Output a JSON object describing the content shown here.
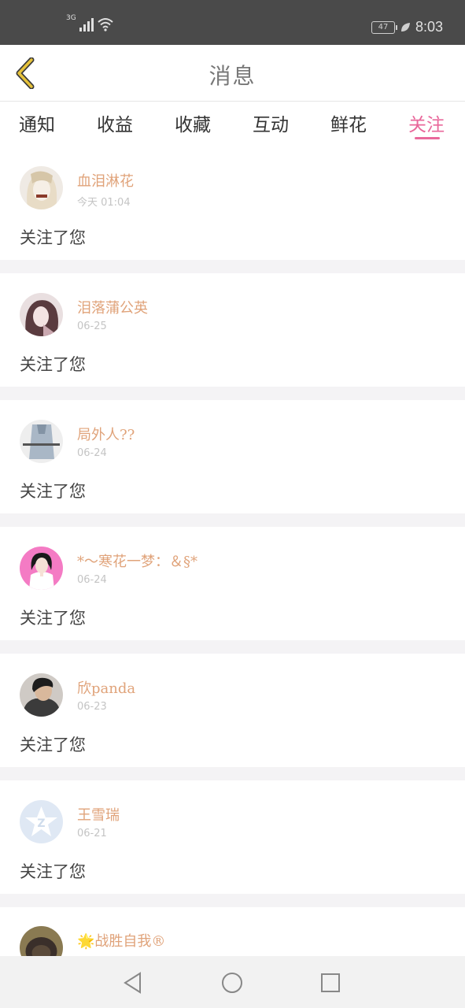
{
  "status_bar": {
    "network": "3G",
    "battery": "47",
    "time": "8:03"
  },
  "header": {
    "title": "消息"
  },
  "tabs": [
    {
      "label": "通知"
    },
    {
      "label": "收益"
    },
    {
      "label": "收藏"
    },
    {
      "label": "互动"
    },
    {
      "label": "鲜花"
    },
    {
      "label": "关注",
      "active": true
    }
  ],
  "notifications": [
    {
      "username": "血泪淋花",
      "time": "今天 01:04",
      "message": "关注了您"
    },
    {
      "username": "泪落蒲公英",
      "time": "06-25",
      "message": "关注了您"
    },
    {
      "username": "局外人??",
      "time": "06-24",
      "message": "关注了您"
    },
    {
      "username": "*〜寒花一梦：＆§*",
      "time": "06-24",
      "message": "关注了您"
    },
    {
      "username": "欣panda",
      "time": "06-23",
      "message": "关注了您"
    },
    {
      "username": "王雪瑞",
      "time": "06-21",
      "message": "关注了您"
    },
    {
      "username": "🌟战胜自我®",
      "time": "",
      "message": ""
    }
  ],
  "colors": {
    "accent": "#e9689b",
    "username": "#e0a37a",
    "back_icon": "#e6c23a"
  }
}
